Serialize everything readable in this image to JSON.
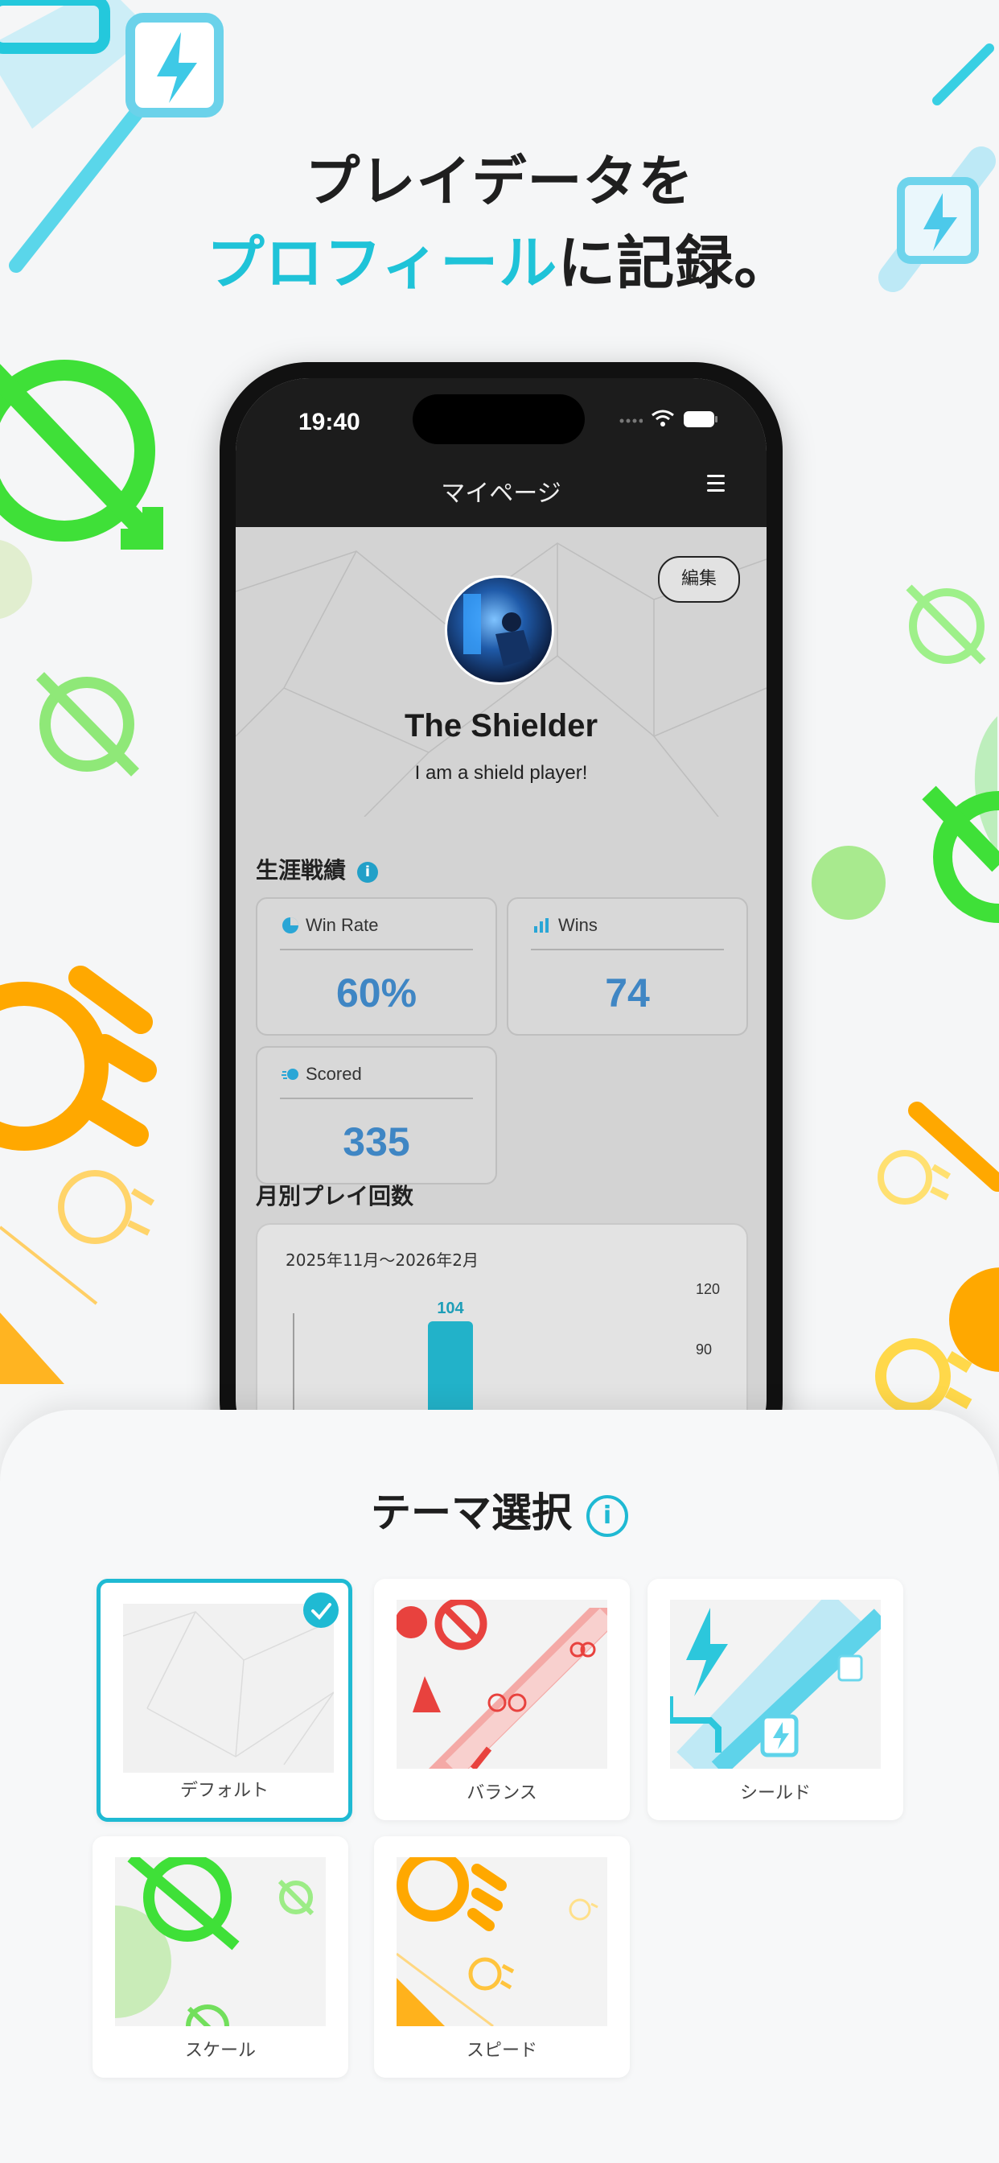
{
  "headline": {
    "line1": "プレイデータを",
    "line2_accent": "プロフィール",
    "line2_rest": "に記録。"
  },
  "phone": {
    "status": {
      "time": "19:40"
    },
    "nav": {
      "title": "マイページ",
      "menu_icon": "hamburger-menu-icon"
    },
    "profile": {
      "edit_label": "編集",
      "name": "The Shielder",
      "bio": "I am a shield player!"
    },
    "stats": {
      "title": "生涯戦績",
      "cards": [
        {
          "label": "Win Rate",
          "value": "60%",
          "icon": "pie-chart-icon"
        },
        {
          "label": "Wins",
          "value": "74",
          "icon": "bar-chart-icon"
        },
        {
          "label": "Scored",
          "value": "335",
          "icon": "ball-icon"
        }
      ]
    },
    "monthly": {
      "title": "月別プレイ回数",
      "range": "2025年11月～2026年2月"
    }
  },
  "chart_data": {
    "type": "bar",
    "categories": [
      ""
    ],
    "values": [
      104
    ],
    "value_labels": [
      "104"
    ],
    "yticks": [
      "120",
      "90"
    ],
    "ylim": [
      0,
      120
    ]
  },
  "theme_sheet": {
    "title": "テーマ選択",
    "themes": [
      {
        "label": "デフォルト",
        "selected": true
      },
      {
        "label": "バランス",
        "selected": false
      },
      {
        "label": "シールド",
        "selected": false
      },
      {
        "label": "スケール",
        "selected": false
      },
      {
        "label": "スピード",
        "selected": false
      }
    ]
  },
  "colors": {
    "accent": "#1fc3d8",
    "green": "#3ee03a",
    "orange": "#ffa800",
    "red": "#e8423e",
    "stat_blue": "#3f86c4"
  }
}
